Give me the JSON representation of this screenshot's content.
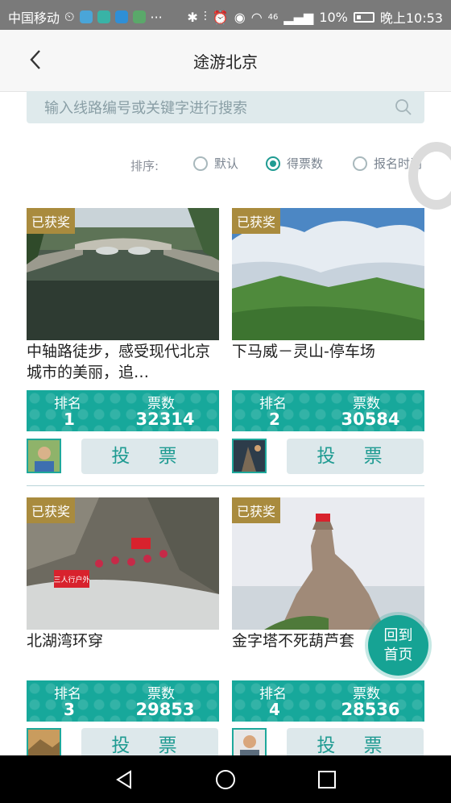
{
  "status_bar": {
    "carrier": "中国移动",
    "network": "46",
    "battery": "10%",
    "time": "晚上10:53",
    "more": "···"
  },
  "header": {
    "title": "途游北京"
  },
  "search": {
    "placeholder": "输入线路编号或关键字进行搜索"
  },
  "sort": {
    "label": "排序:",
    "options": [
      {
        "label": "默认",
        "selected": false
      },
      {
        "label": "得票数",
        "selected": true
      },
      {
        "label": "报名时间",
        "selected": false
      }
    ]
  },
  "cards": [
    {
      "badge": "已获奖",
      "caption": "中轴路徒步，感受现代北京城市的美丽，追…",
      "rank_label": "排名",
      "rank": "1",
      "votes_label": "票数",
      "votes": "32314",
      "vote_button": "投 票"
    },
    {
      "badge": "已获奖",
      "caption": "下马威－灵山-停车场",
      "rank_label": "排名",
      "rank": "2",
      "votes_label": "票数",
      "votes": "30584",
      "vote_button": "投 票"
    },
    {
      "badge": "已获奖",
      "caption": "北湖湾环穿",
      "rank_label": "排名",
      "rank": "3",
      "votes_label": "票数",
      "votes": "29853",
      "vote_button": "投 票"
    },
    {
      "badge": "已获奖",
      "caption": "金字塔不死葫芦套",
      "rank_label": "排名",
      "rank": "4",
      "votes_label": "票数",
      "votes": "28536",
      "vote_button": "投 票"
    }
  ],
  "photo_banner_text": "三人行户外",
  "float_button": {
    "line1": "回到",
    "line2": "首页"
  },
  "colors": {
    "accent": "#17a89b",
    "badge": "#a98b3e",
    "status_bar": "#7a7a7a"
  }
}
